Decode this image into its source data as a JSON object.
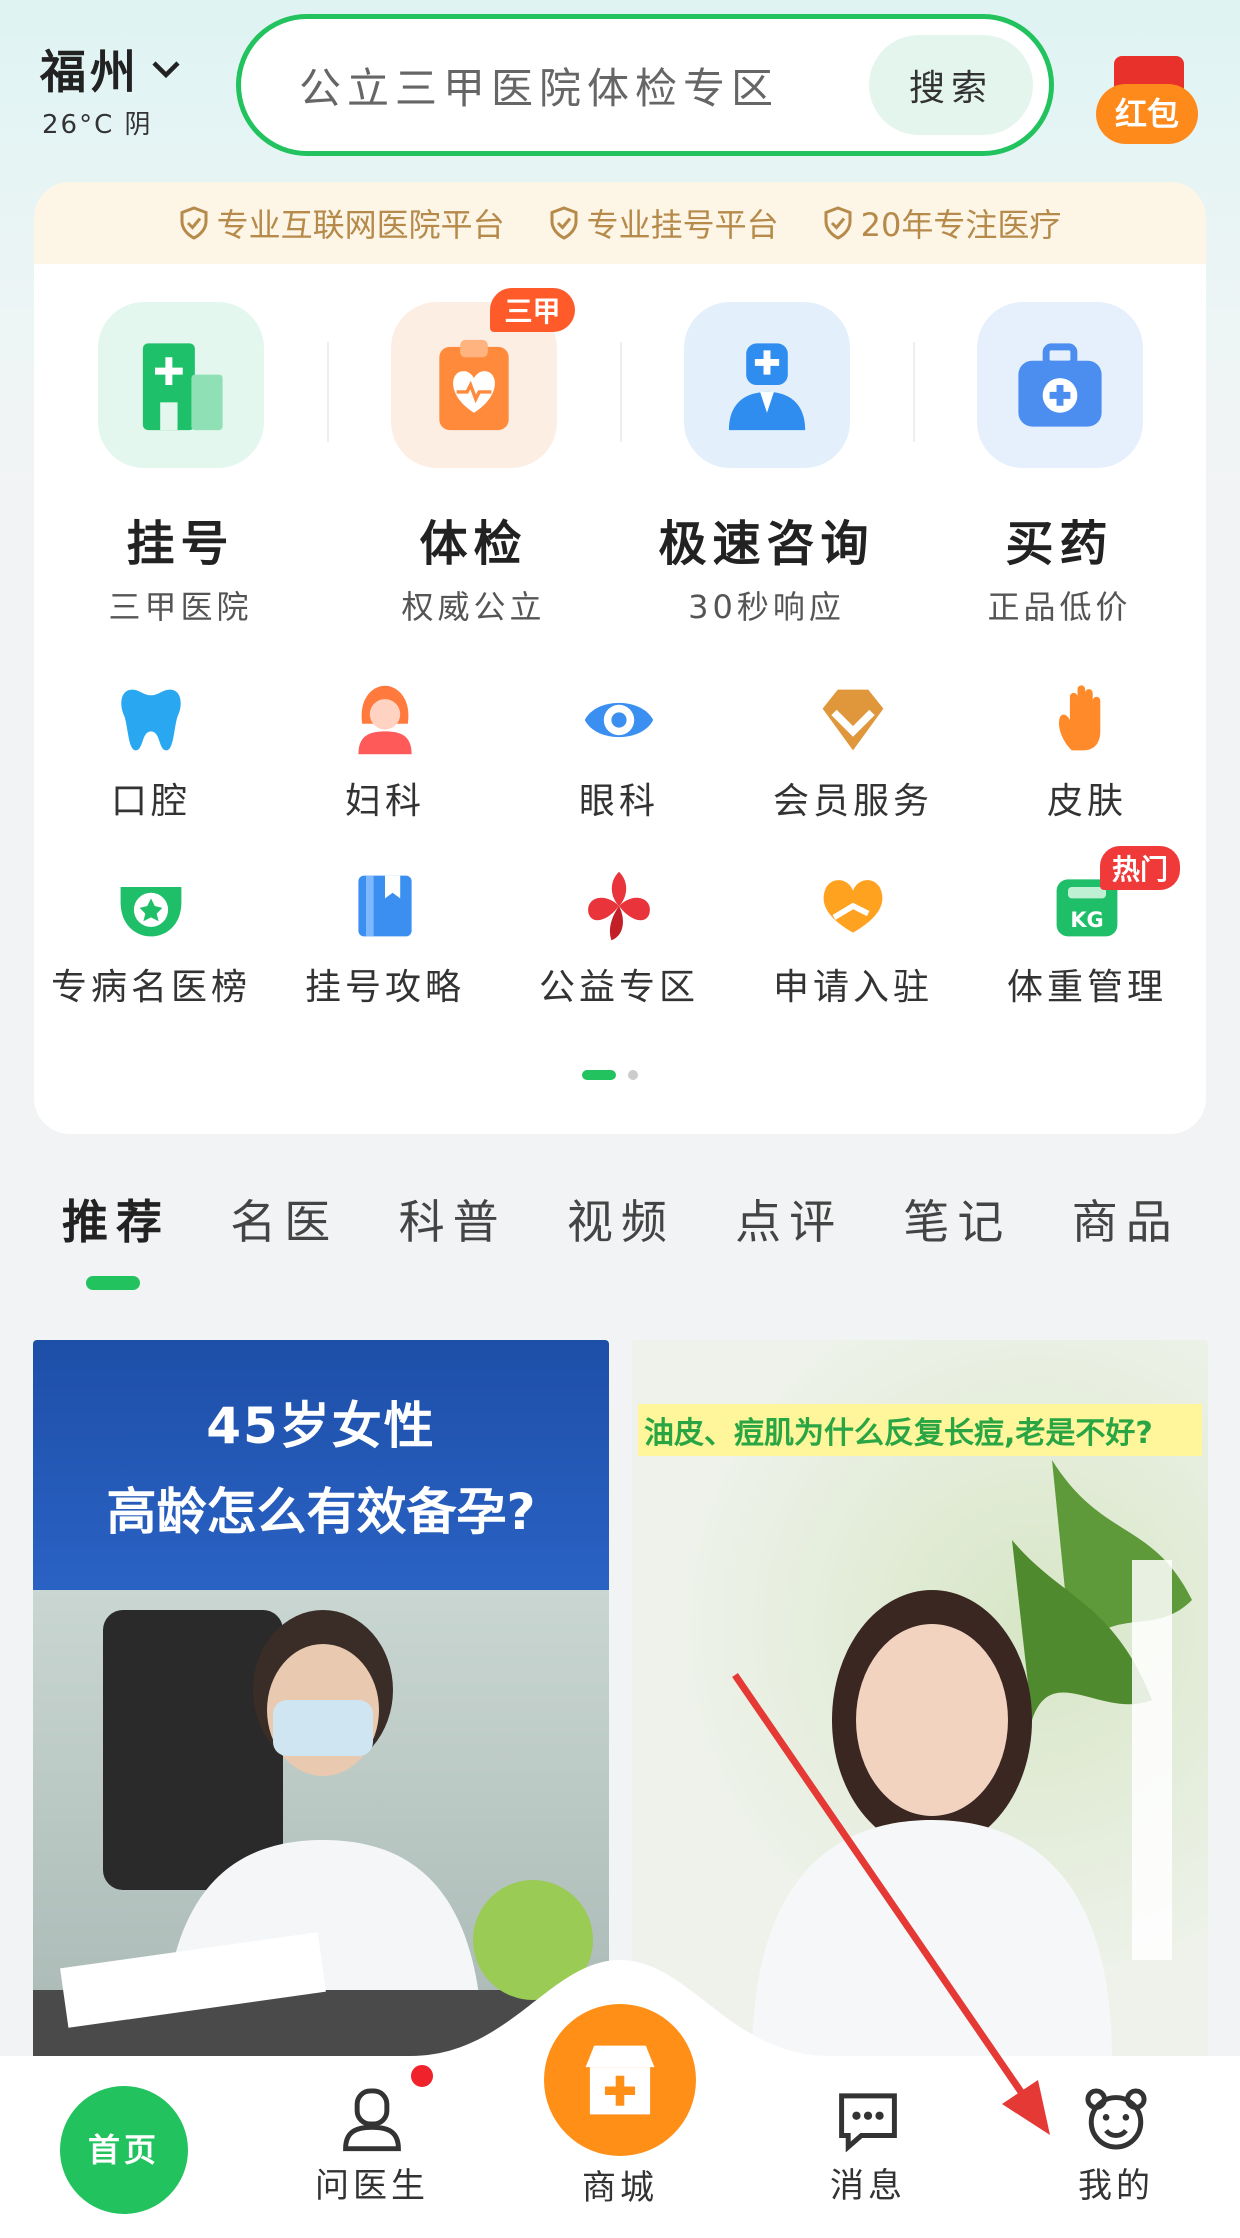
{
  "header": {
    "city": "福州",
    "weather": "26°C  阴",
    "search_placeholder": "公立三甲医院体检专区",
    "search_button": "搜索",
    "redpacket_label": "红包"
  },
  "trust_badges": [
    "专业互联网医院平台",
    "专业挂号平台",
    "20年专注医疗"
  ],
  "main_services": [
    {
      "title": "挂号",
      "subtitle": "三甲医院",
      "icon": "hospital-icon"
    },
    {
      "title": "体检",
      "subtitle": "权威公立",
      "icon": "clipboard-heart-icon",
      "badge": "三甲"
    },
    {
      "title": "极速咨询",
      "subtitle": "30秒响应",
      "icon": "doctor-icon"
    },
    {
      "title": "买药",
      "subtitle": "正品低价",
      "icon": "medicine-kit-icon"
    }
  ],
  "departments": [
    {
      "label": "口腔",
      "icon": "tooth-icon"
    },
    {
      "label": "妇科",
      "icon": "woman-icon"
    },
    {
      "label": "眼科",
      "icon": "eye-icon"
    },
    {
      "label": "会员服务",
      "icon": "diamond-icon"
    },
    {
      "label": "皮肤",
      "icon": "hand-icon"
    },
    {
      "label": "专病名医榜",
      "icon": "ribbon-star-icon"
    },
    {
      "label": "挂号攻略",
      "icon": "book-icon"
    },
    {
      "label": "公益专区",
      "icon": "charity-icon"
    },
    {
      "label": "申请入驻",
      "icon": "heart-hand-icon"
    },
    {
      "label": "体重管理",
      "icon": "scale-icon",
      "badge": "热门"
    }
  ],
  "pager": {
    "pages": 2,
    "current": 1
  },
  "feed_tabs": [
    "推荐",
    "名医",
    "科普",
    "视频",
    "点评",
    "笔记",
    "商品"
  ],
  "feed_active_tab": 0,
  "feed": [
    {
      "line1": "45岁女性",
      "line2": "高龄怎么有效备孕?"
    },
    {
      "title": "油皮、痘肌为什么反复长痘,老是不好?"
    }
  ],
  "bottom_nav": {
    "home": "首页",
    "doctor": "问医生",
    "mall": "商城",
    "messages": "消息",
    "mine": "我的"
  },
  "colors": {
    "accent": "#22c35e",
    "orange": "#ff8f17",
    "red": "#f0222b",
    "annotation_arrow": "#e53935"
  }
}
